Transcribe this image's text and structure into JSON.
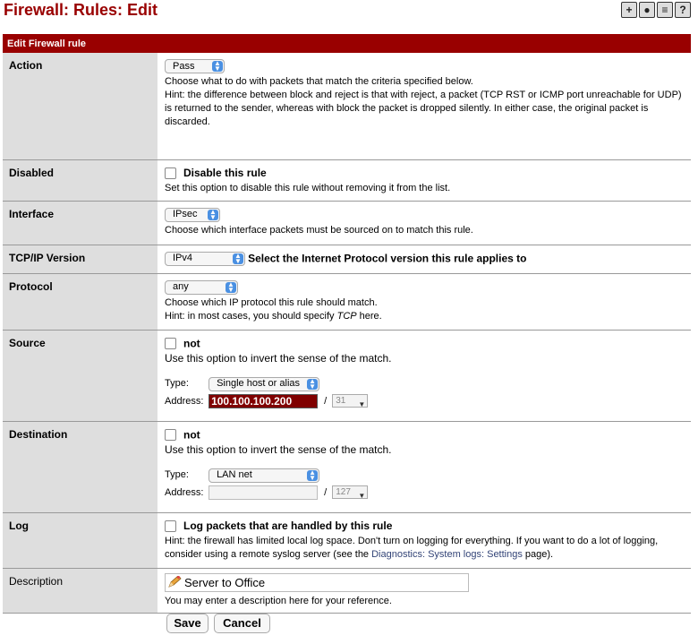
{
  "page": {
    "title": "Firewall: Rules: Edit"
  },
  "table_header": "Edit Firewall rule",
  "rows": {
    "action": {
      "label": "Action",
      "select": "Pass",
      "help1": "Choose what to do with packets that match the criteria specified below.",
      "help2": "Hint: the difference between block and reject is that with reject, a packet (TCP RST or ICMP port unreachable for UDP) is returned to the sender, whereas with block the packet is dropped silently. In either case, the original packet is discarded."
    },
    "disabled": {
      "label": "Disabled",
      "checkbox_label": "Disable this rule",
      "help": "Set this option to disable this rule without removing it from the list."
    },
    "interface": {
      "label": "Interface",
      "select": "IPsec",
      "help": "Choose which interface packets must be sourced on to match this rule."
    },
    "tcpip": {
      "label": "TCP/IP Version",
      "select": "IPv4",
      "help": "Select the Internet Protocol version this rule applies to"
    },
    "protocol": {
      "label": "Protocol",
      "select": "any",
      "help1": "Choose which IP protocol this rule should match.",
      "help2_pre": "Hint: in most cases, you should specify ",
      "help2_em": "TCP",
      "help2_post": "  here."
    },
    "source": {
      "label": "Source",
      "not_label": "not",
      "help": "Use this option to invert the sense of the match.",
      "type_label": "Type:",
      "type_value": "Single host or alias",
      "address_label": "Address:",
      "address_value": "100.100.100.200",
      "slash": "/",
      "mask": "31"
    },
    "destination": {
      "label": "Destination",
      "not_label": "not",
      "help": "Use this option to invert the sense of the match.",
      "type_label": "Type:",
      "type_value": "LAN net",
      "address_label": "Address:",
      "address_value": "",
      "slash": "/",
      "mask": "127"
    },
    "log": {
      "label": "Log",
      "checkbox_label": "Log packets that are handled by this rule",
      "help_pre": "Hint: the firewall has limited local log space. Don't turn on logging for everything. If you want to do a lot of logging, consider using a remote syslog server (see the ",
      "help_link": "Diagnostics: System logs: Settings",
      "help_post": " page)."
    },
    "description": {
      "label": "Description",
      "value": "Server to Office",
      "help": "You may enter a description here for your reference."
    }
  },
  "buttons": {
    "save": "Save",
    "cancel": "Cancel"
  },
  "colors": {
    "header_bg": "#990000",
    "title": "#990000",
    "highlight": "#800000",
    "select_arrow": "#4a90e2"
  }
}
